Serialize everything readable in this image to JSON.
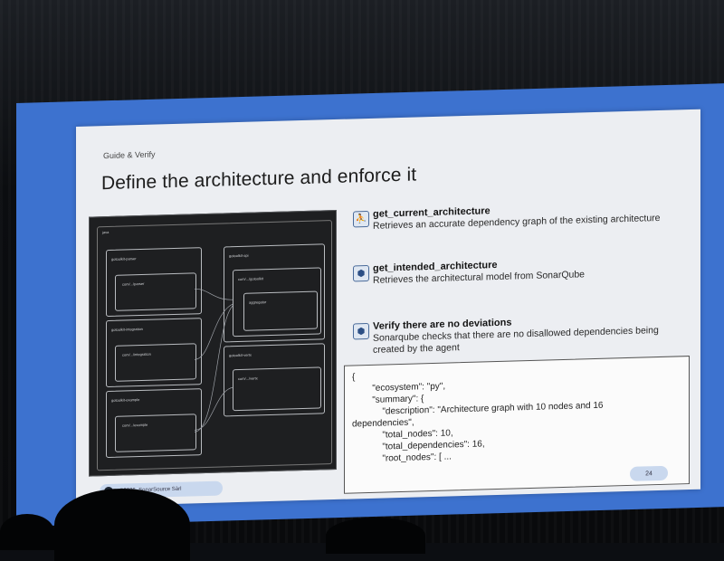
{
  "slide": {
    "kicker": "Guide & Verify",
    "title": "Define the architecture and enforce it",
    "page_number": "24",
    "footer": "©2026, SonarSource Sàrl"
  },
  "diagram": {
    "root_label": "java",
    "groups": [
      {
        "label": "gotoolkit-parser",
        "inner": "com/.../parser"
      },
      {
        "label": "gotoolkit-integration",
        "inner": "com/.../integration"
      },
      {
        "label": "gotoolkit-example",
        "inner": "com/.../example"
      },
      {
        "label": "gotoolkit-api",
        "inner": "com/.../gotoolkit",
        "inner2": "aggregator"
      },
      {
        "label": "gotoolkit-vertx",
        "inner": "com/.../vertx"
      }
    ]
  },
  "tools": [
    {
      "icon": "person-graph-icon",
      "name": "get_current_architecture",
      "desc": "Retrieves an accurate dependency graph of the existing architecture"
    },
    {
      "icon": "cube-icon",
      "name": "get_intended_architecture",
      "desc": "Retrieves the architectural model from SonarQube"
    },
    {
      "icon": "cube-icon",
      "name": "Verify there are no deviations",
      "desc": "Sonarqube checks that there are no disallowed dependencies being created by the agent"
    }
  ],
  "code": {
    "lines": [
      "{",
      "        \"ecosystem\": \"py\",",
      "        \"summary\": {",
      "            \"description\": \"Architecture graph with 10 nodes and 16",
      "dependencies\",",
      "            \"total_nodes\": 10,",
      "            \"total_dependencies\": 16,",
      "            \"root_nodes\": [ ..."
    ]
  },
  "colors": {
    "screen_border": "#3d72cf",
    "slide_bg": "#eceef2",
    "diagram_bg": "#1e1f21",
    "pill_bg": "#c9d8ee"
  }
}
